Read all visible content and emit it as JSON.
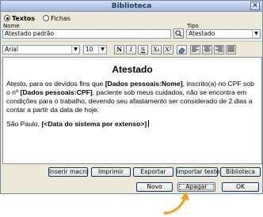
{
  "window": {
    "title": "Biblioteca",
    "close_glyph": "×"
  },
  "mode": {
    "options": [
      "Textos",
      "Fichas"
    ],
    "selected": "Textos"
  },
  "name_field": {
    "label": "Nome",
    "value": "Atestado padrão"
  },
  "type_field": {
    "label": "Tipo",
    "value": "Atestado"
  },
  "font": {
    "family": "Arial",
    "size": "10"
  },
  "format_buttons": [
    "N",
    "I",
    "S",
    "X₂",
    "X²"
  ],
  "align_buttons": [
    "align-left-icon",
    "align-center-icon",
    "align-right-icon",
    "align-justify-icon"
  ],
  "document": {
    "title": "Atestado",
    "p1_a": "Atesto, para os devidos fins que ",
    "p1_tag1": "[Dados pessoais:Nome]",
    "p1_b": ", inscrito(a) no CPF sob o nº ",
    "p1_tag2": "[Dados pessoais:CPF]",
    "p1_c": ", paciente sob meus cuidados, não se encontra em condições para o trabalho, devendo seu afastamento ser considerado de 2 dias a contar a partir da data de hoje.",
    "p2_a": "São Paulo, ",
    "p2_tag": "[<Data do sistema por extenso>]"
  },
  "actions": {
    "insert_macro": "Inserir macro",
    "print": "Imprimir",
    "export": "Exportar",
    "import": "Importar texto",
    "library": "Biblioteca"
  },
  "footer": {
    "new": "Novo",
    "delete": "Apagar",
    "ok": "OK"
  },
  "colors": {
    "pointer_arrow": "#f0a020",
    "title_bar": "#b9cbe9"
  }
}
